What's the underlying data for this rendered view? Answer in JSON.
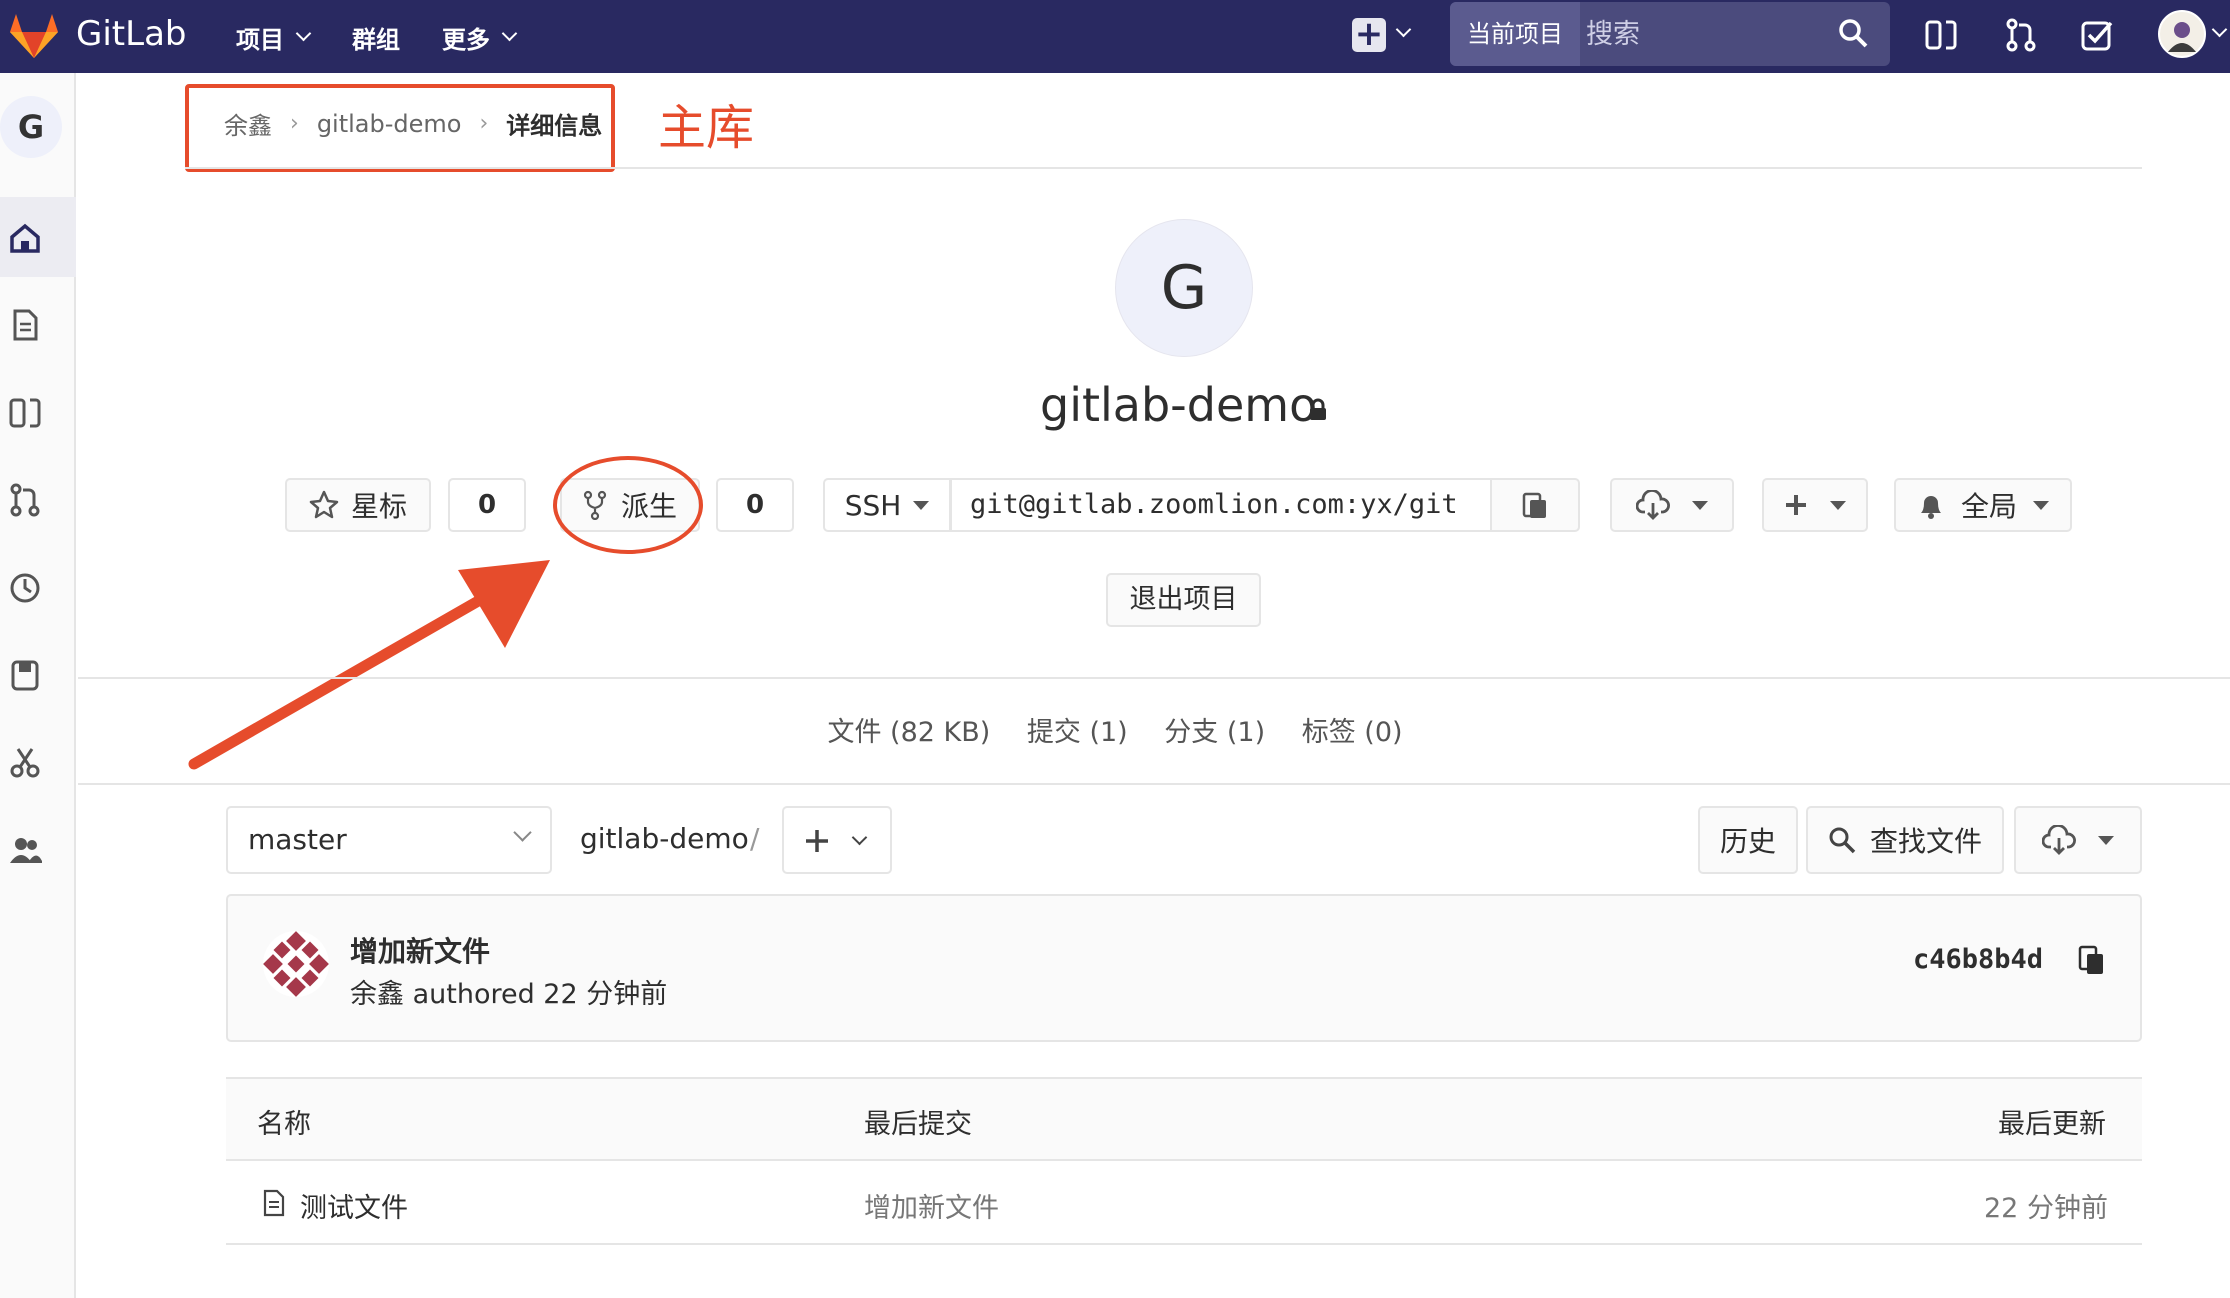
{
  "topnav": {
    "brand": "GitLab",
    "menu_projects": "项目",
    "menu_groups": "群组",
    "menu_more": "更多",
    "search_scope": "当前项目",
    "search_placeholder": "搜索"
  },
  "sidebar": {
    "project_initial": "G"
  },
  "breadcrumb": {
    "owner": "余鑫",
    "project": "gitlab-demo",
    "current": "详细信息",
    "separator": "›"
  },
  "annotation": {
    "label": "主库",
    "highlight_color": "#e64c2c"
  },
  "project": {
    "avatar_initial": "G",
    "name": "gitlab-demo",
    "star_label": "星标",
    "star_count": "0",
    "fork_label": "派生",
    "fork_count": "0",
    "clone_protocol": "SSH",
    "clone_url": "git@gitlab.zoomlion.com:yx/git",
    "notification_level": "全局",
    "leave_label": "退出项目"
  },
  "stats": {
    "files": "文件 (82 KB)",
    "commits": "提交 (1)",
    "branches": "分支 (1)",
    "tags": "标签 (0)"
  },
  "browser": {
    "branch": "master",
    "path_root": "gitlab-demo",
    "path_sep": "/",
    "history_label": "历史",
    "find_file_label": "查找文件"
  },
  "last_commit": {
    "title": "增加新文件",
    "author_line": "余鑫 authored 22 分钟前",
    "sha": "c46b8b4d"
  },
  "file_table": {
    "columns": [
      "名称",
      "最后提交",
      "最后更新"
    ],
    "rows": [
      {
        "name": "测试文件",
        "last_commit": "增加新文件",
        "updated": "22 分钟前"
      }
    ]
  },
  "colors": {
    "nav_bg": "#292961",
    "accent_red": "#e64c2c"
  }
}
